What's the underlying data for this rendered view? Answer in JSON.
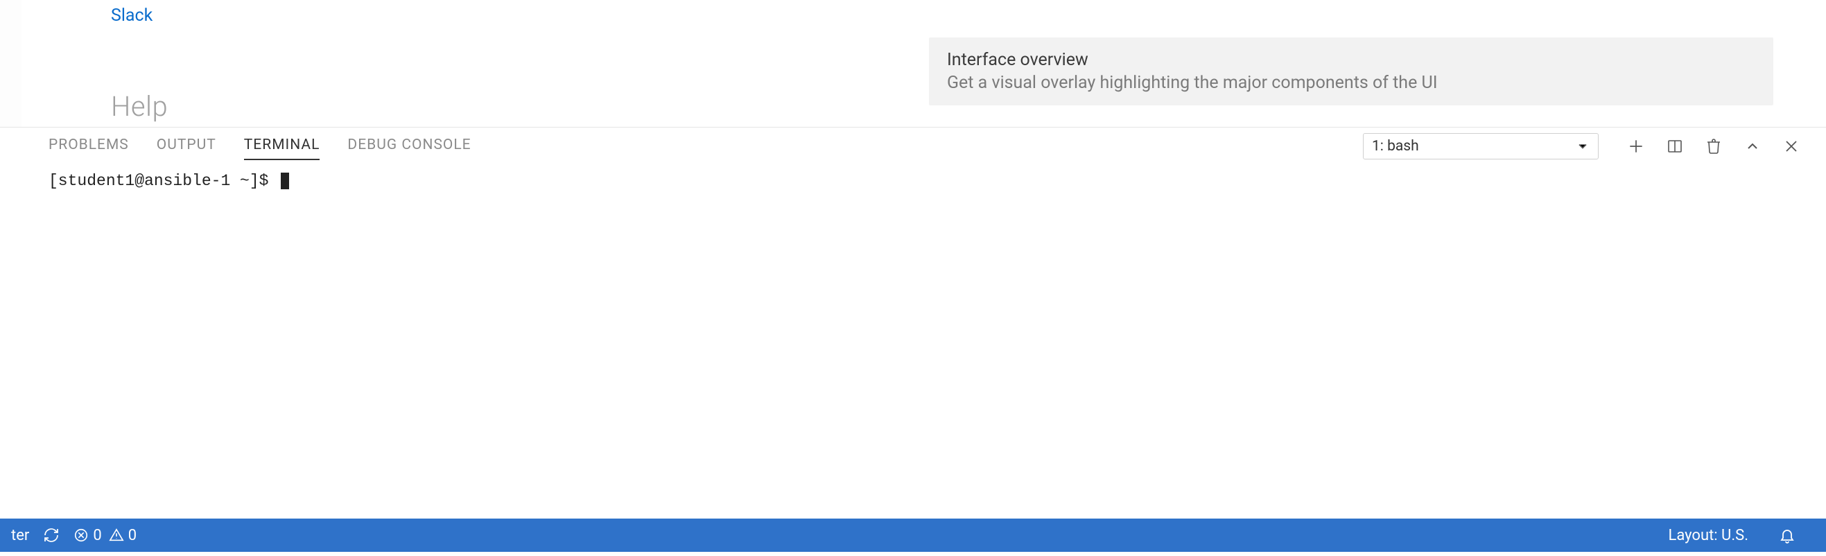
{
  "welcome": {
    "link_slack": "Slack",
    "help_heading": "Help",
    "card": {
      "title": "Interface overview",
      "subtitle": "Get a visual overlay highlighting the major components of the UI"
    }
  },
  "panel": {
    "tabs": {
      "problems": "PROBLEMS",
      "output": "OUTPUT",
      "terminal": "TERMINAL",
      "debug_console": "DEBUG CONSOLE"
    },
    "terminal_select": "1: bash",
    "terminal_prompt": "[student1@ansible-1 ~]$ "
  },
  "statusbar": {
    "left_fragment": "ter",
    "errors": "0",
    "warnings": "0",
    "layout": "Layout: U.S."
  }
}
